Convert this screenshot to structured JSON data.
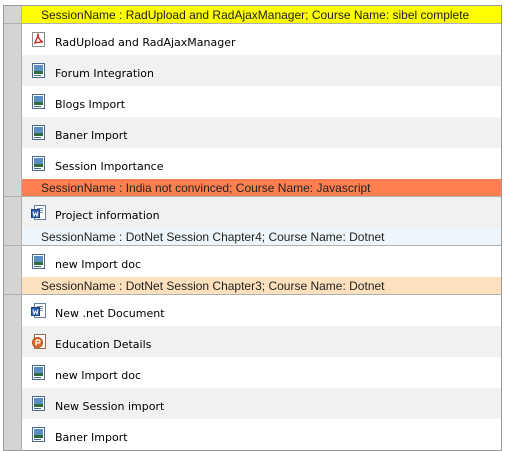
{
  "groups": [
    {
      "header": "SessionName : RadUpload and RadAjaxManager; Course Name: sibel complete",
      "color": "#ffff00",
      "items": [
        {
          "label": "RadUpload and RadAjaxManager",
          "icon": "pdf-file-icon"
        },
        {
          "label": "Forum Integration",
          "icon": "generic-file-icon"
        },
        {
          "label": "Blogs Import",
          "icon": "generic-file-icon"
        },
        {
          "label": "Baner Import",
          "icon": "generic-file-icon"
        },
        {
          "label": "Session Importance",
          "icon": "generic-file-icon"
        }
      ]
    },
    {
      "header": "SessionName : India not convinced; Course Name: Javascript",
      "color": "#ff7f50",
      "items": [
        {
          "label": "Project information",
          "icon": "word-file-icon"
        }
      ]
    },
    {
      "header": "SessionName : DotNet Session Chapter4; Course Name: Dotnet",
      "color": "#eef6fb",
      "items": [
        {
          "label": "new Import doc",
          "icon": "generic-file-icon"
        }
      ]
    },
    {
      "header": "SessionName : DotNet Session Chapter3; Course Name: Dotnet",
      "color": "#fde0bd",
      "items": [
        {
          "label": "New .net Document",
          "icon": "word-file-icon"
        },
        {
          "label": "Education Details",
          "icon": "powerpoint-file-icon"
        },
        {
          "label": "new Import doc",
          "icon": "generic-file-icon"
        },
        {
          "label": "New Session import",
          "icon": "generic-file-icon"
        },
        {
          "label": "Baner Import",
          "icon": "generic-file-icon"
        }
      ]
    }
  ]
}
